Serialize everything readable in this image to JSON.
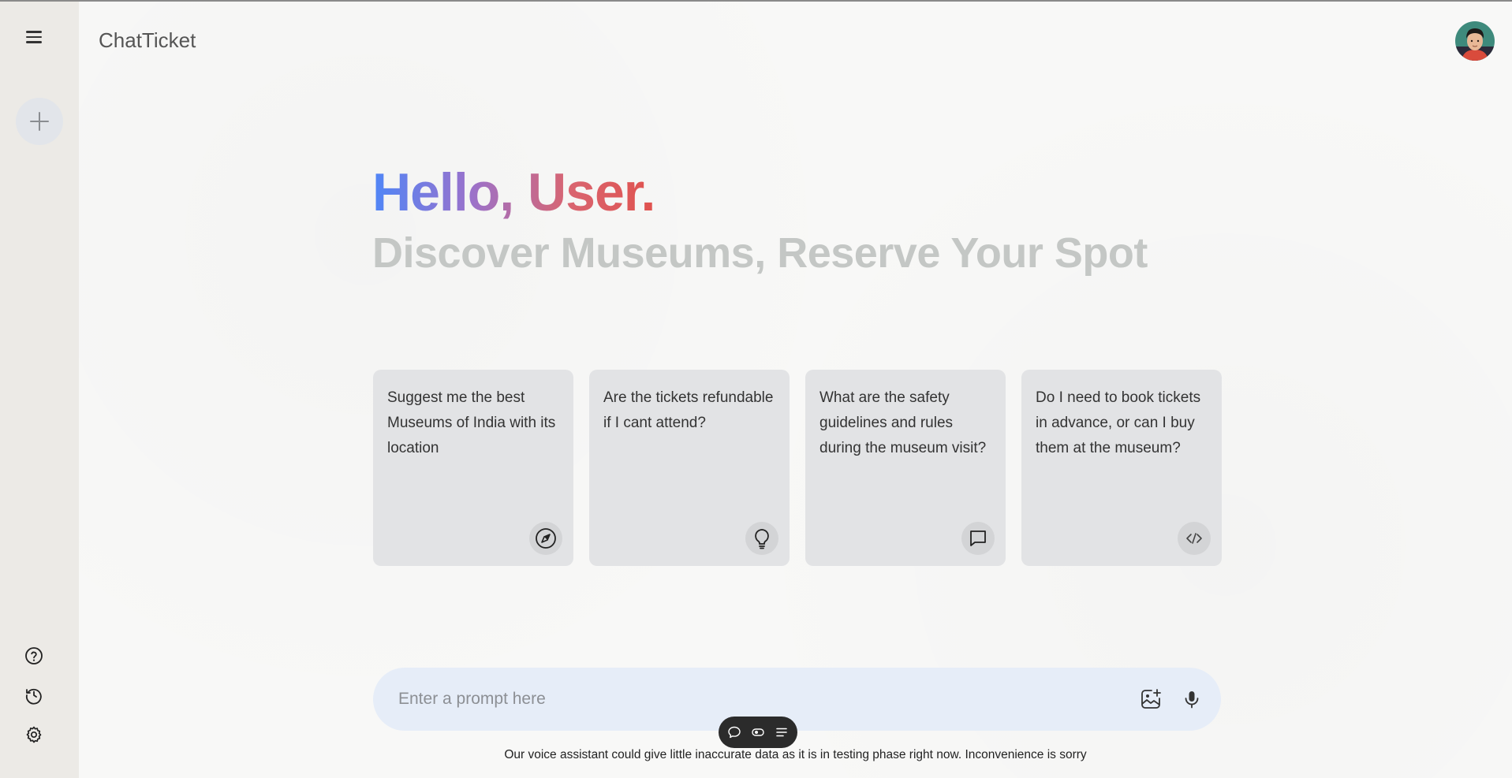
{
  "app": {
    "title": "ChatTicket"
  },
  "sidebar": {
    "menu_icon": "hamburger-menu-icon",
    "new_chat_icon": "plus-icon",
    "bottom_items": [
      {
        "icon": "help-icon"
      },
      {
        "icon": "history-icon"
      },
      {
        "icon": "gear-icon"
      }
    ]
  },
  "hero": {
    "greeting": "Hello, User.",
    "subtitle": "Discover Museums, Reserve Your Spot"
  },
  "cards": [
    {
      "text": "Suggest me the best Museums of India with its location",
      "icon": "compass-icon"
    },
    {
      "text": "Are the tickets refundable if I cant attend?",
      "icon": "lightbulb-icon"
    },
    {
      "text": "What are the safety guidelines and rules during the museum visit?",
      "icon": "chat-bubble-icon"
    },
    {
      "text": "Do I need to book tickets in advance, or can I buy them at the museum?",
      "icon": "code-icon"
    }
  ],
  "prompt": {
    "placeholder": "Enter a prompt here",
    "value": "",
    "image_icon": "image-add-icon",
    "mic_icon": "microphone-icon"
  },
  "mini_toolbar": {
    "icons": [
      "chat-bubble-icon",
      "toggle-icon",
      "list-icon"
    ]
  },
  "footer": {
    "disclaimer": "Our voice assistant could give little inaccurate data as it is in testing phase right now. Inconvenience is sorry"
  },
  "colors": {
    "sidebar_bg": "#eceae6",
    "card_bg": "#e2e3e5",
    "prompt_bg": "#e6edf8",
    "greeting_gradient": [
      "#4f86f7",
      "#9b72cb",
      "#d96570",
      "#e0524e"
    ],
    "subtitle_color": "#c4c7c5"
  }
}
